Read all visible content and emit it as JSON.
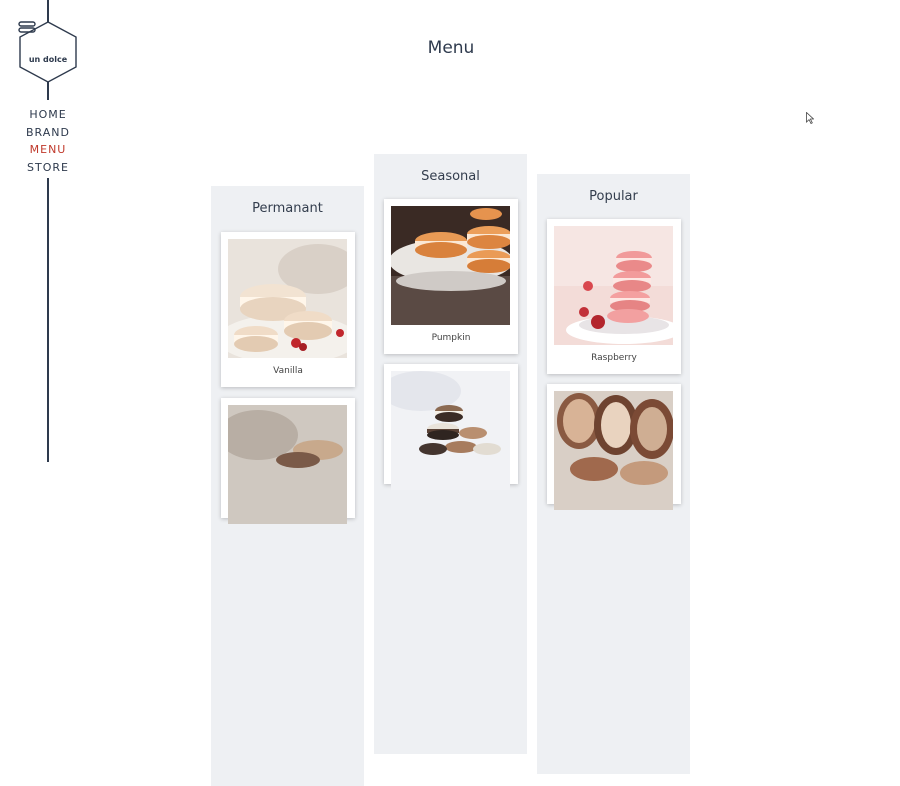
{
  "brand": {
    "name": "un dolce",
    "icon": "macaron-icon"
  },
  "nav": {
    "items": [
      {
        "label": "HOME",
        "active": false
      },
      {
        "label": "BRAND",
        "active": false
      },
      {
        "label": "MENU",
        "active": true
      },
      {
        "label": "STORE",
        "active": false
      }
    ]
  },
  "page": {
    "title": "Menu"
  },
  "columns": [
    {
      "title": "Permanant",
      "cards": [
        {
          "label": "Vanilla"
        },
        {
          "label": ""
        }
      ]
    },
    {
      "title": "Seasonal",
      "cards": [
        {
          "label": "Pumpkin"
        },
        {
          "label": ""
        }
      ]
    },
    {
      "title": "Popular",
      "cards": [
        {
          "label": "Raspberry"
        },
        {
          "label": ""
        }
      ]
    }
  ],
  "colors": {
    "text": "#2e3a4d",
    "accent": "#c0392b",
    "column_bg": "#eef0f3"
  }
}
